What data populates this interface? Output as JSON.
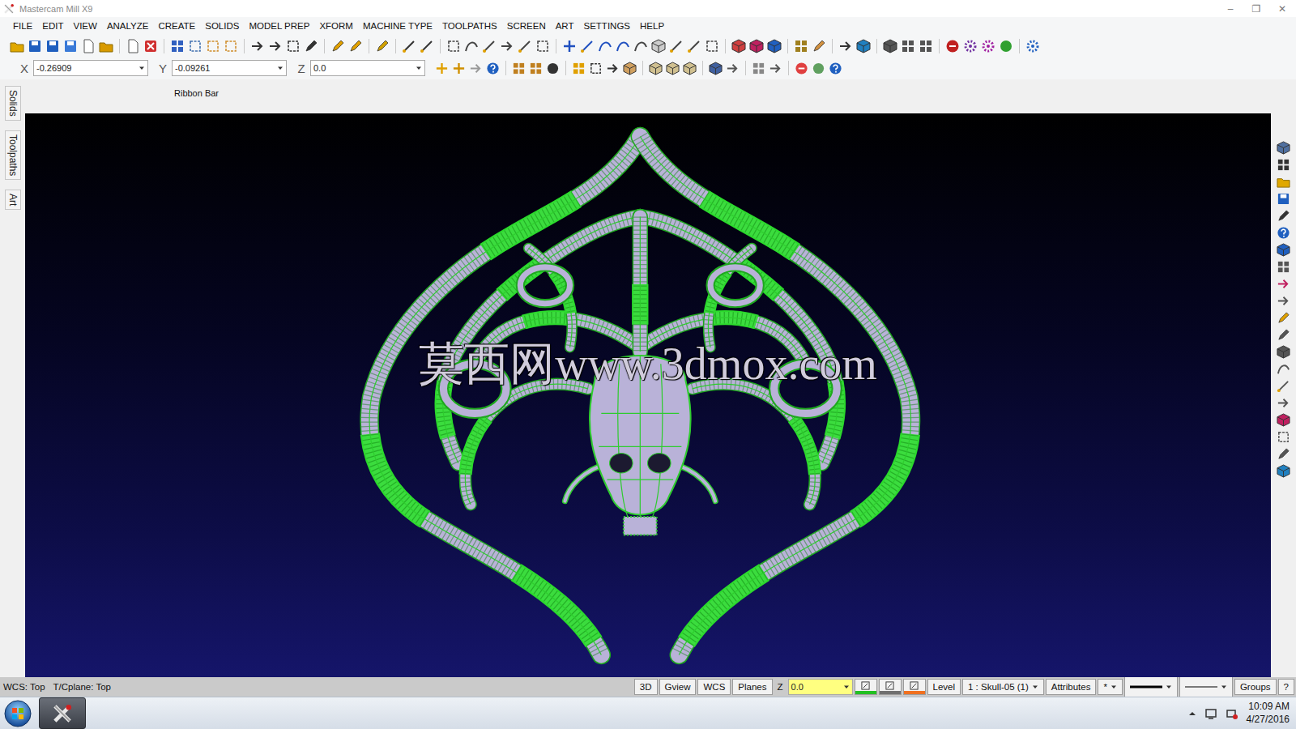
{
  "window": {
    "title": "Mastercam Mill X9",
    "controls": [
      "–",
      "❐",
      "✕"
    ]
  },
  "menu": [
    "FILE",
    "EDIT",
    "VIEW",
    "ANALYZE",
    "CREATE",
    "SOLIDS",
    "MODEL PREP",
    "XFORM",
    "MACHINE TYPE",
    "TOOLPATHS",
    "SCREEN",
    "ART",
    "SETTINGS",
    "HELP"
  ],
  "coordinates": [
    {
      "label": "X",
      "value": "-0.26909"
    },
    {
      "label": "Y",
      "value": "-0.09261"
    },
    {
      "label": "Z",
      "value": "0.0"
    }
  ],
  "ribbon": {
    "label": "Ribbon Bar"
  },
  "side_tabs": [
    {
      "label": "Solids"
    },
    {
      "label": "Toolpaths"
    },
    {
      "label": "Art"
    }
  ],
  "viewport": {
    "watermark": "莫西网www.3dmox.com"
  },
  "status_bar": {
    "planes": [
      "WCS: Top",
      "T/Cplane: Top"
    ],
    "buttons": [
      "3D",
      "Gview",
      "WCS",
      "Planes"
    ],
    "z_label": "Z",
    "z_value": "0.0",
    "swatches": [
      {
        "color": "#22c022"
      },
      {
        "color": "#707070"
      },
      {
        "color": "#f07020"
      }
    ],
    "level_label": "Level",
    "level_value": "1 : Skull-05 (1)",
    "attributes": "Attributes",
    "point_style": "*",
    "groups": "Groups",
    "help": "?"
  },
  "taskbar": {
    "time": "10:09 AM",
    "date": "4/27/2016"
  }
}
